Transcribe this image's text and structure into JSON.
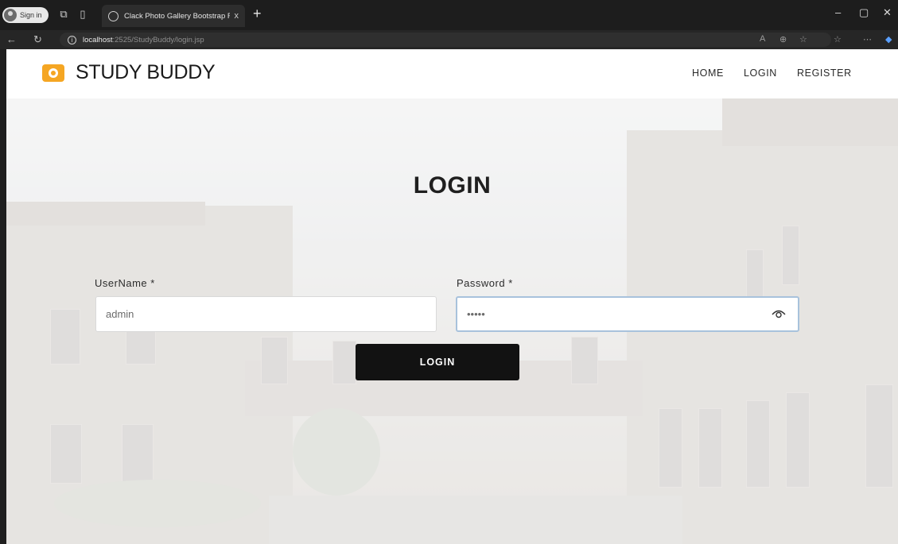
{
  "browser": {
    "profile_label": "Sign in",
    "tab_title": "Clack Photo Gallery Bootstrap Re",
    "tab_close": "x",
    "new_tab": "+",
    "url_host": "localhost",
    "url_path": ":2525/StudyBuddy/login.jsp",
    "window_controls": [
      "–",
      "▢",
      "✕"
    ]
  },
  "site": {
    "brand": "STUDY BUDDY",
    "nav": [
      "HOME",
      "LOGIN",
      "REGISTER"
    ]
  },
  "login": {
    "title": "LOGIN",
    "username_label": "UserName *",
    "username_value": "admin",
    "password_label": "Password *",
    "password_value": "•••••",
    "submit_label": "LOGIN"
  },
  "icons": [
    "profile-avatar-icon",
    "tab-group-icon",
    "tab-actions-icon",
    "globe-icon",
    "back-icon",
    "reload-icon",
    "info-icon",
    "read-aloud-icon",
    "zoom-icon",
    "favorite-icon",
    "favorites-bar-icon",
    "more-icon",
    "copilot-icon",
    "camera-logo-icon",
    "eye-icon"
  ],
  "colors": {
    "brand_accent": "#f5a623",
    "button_bg": "#121212",
    "password_focus_border": "#a8c2dc"
  }
}
